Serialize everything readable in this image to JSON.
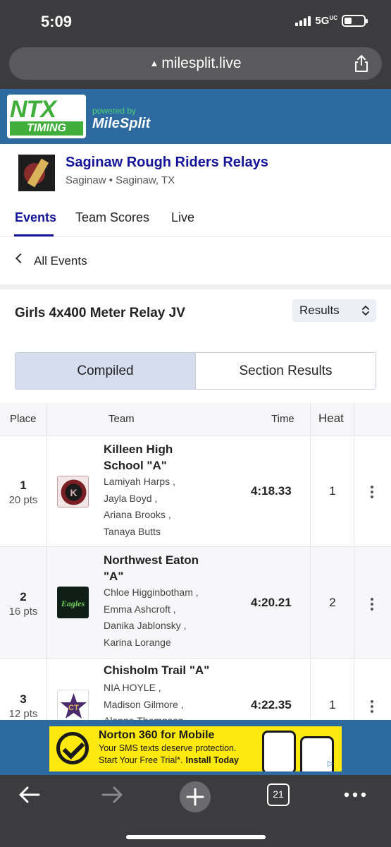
{
  "status": {
    "time": "5:09",
    "network": "5G",
    "network_suffix": "UC"
  },
  "browser": {
    "url": "milesplit.live"
  },
  "brand": {
    "logo_top": "NTX",
    "logo_bottom": "TIMING",
    "powered_by": "powered by",
    "milesplit": "MileSplit"
  },
  "meet": {
    "title": "Saginaw Rough Riders Relays",
    "location": "Saginaw • Saginaw, TX"
  },
  "tabs": [
    {
      "label": "Events"
    },
    {
      "label": "Team Scores"
    },
    {
      "label": "Live"
    }
  ],
  "back": {
    "label": "All Events"
  },
  "event": {
    "title": "Girls 4x400 Meter Relay JV",
    "view_select": "Results"
  },
  "segments": [
    {
      "label": "Compiled",
      "active": true
    },
    {
      "label": "Section Results",
      "active": false
    }
  ],
  "table": {
    "headers": {
      "place": "Place",
      "team": "Team",
      "time": "Time",
      "heat": "Heat"
    },
    "rows": [
      {
        "place": "1",
        "points": "20 pts",
        "team_line1": "Killeen High",
        "team_line2": "School \"A\"",
        "athletes": [
          "Lamiyah Harps ,",
          "Jayla Boyd ,",
          "Ariana Brooks ,",
          "Tanaya Butts"
        ],
        "time": "4:18.33",
        "heat": "1",
        "logo_color": "#7a1f24"
      },
      {
        "place": "2",
        "points": "16 pts",
        "team_line1": "Northwest Eaton",
        "team_line2": "\"A\"",
        "athletes": [
          "Chloe Higginbotham ,",
          "Emma Ashcroft ,",
          "Danika Jablonsky ,",
          "Karina Lorange"
        ],
        "time": "4:20.21",
        "heat": "2",
        "logo_color": "#0f3b24",
        "logo_text": "Eagles"
      },
      {
        "place": "3",
        "points": "12 pts",
        "team_line1": "Chisholm Trail \"A\"",
        "team_line2": "",
        "athletes": [
          "NIA HOYLE ,",
          "Madison Gilmore ,",
          "Alanna Thompson ,"
        ],
        "time": "4:22.35",
        "heat": "1",
        "logo_color": "#4b2a6e",
        "logo_text": "CT"
      }
    ]
  },
  "ad": {
    "title": "Norton 360 for Mobile",
    "line1": "Your SMS texts deserve protection.",
    "line2": "Start Your Free Trial*.",
    "cta": "Install Today"
  },
  "toolbar": {
    "tab_count": "21"
  }
}
